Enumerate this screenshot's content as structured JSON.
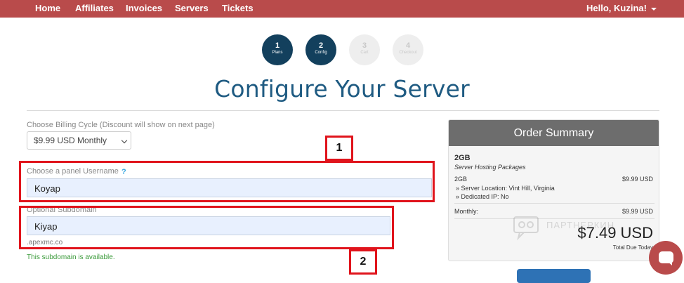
{
  "nav": {
    "links": [
      "Home",
      "Affiliates",
      "Invoices",
      "Servers",
      "Tickets"
    ],
    "user_greeting": "Hello, Kuzina!"
  },
  "steps": [
    {
      "num": "1",
      "label": "Plans",
      "state": "active"
    },
    {
      "num": "2",
      "label": "Config",
      "state": "active"
    },
    {
      "num": "3",
      "label": "Cart",
      "state": "inactive"
    },
    {
      "num": "4",
      "label": "Checkout",
      "state": "inactive"
    }
  ],
  "page_title": "Configure Your Server",
  "form": {
    "billing_label": "Choose Billing Cycle (Discount will show on next page)",
    "billing_value": "$9.99 USD Monthly",
    "username_label": "Choose a panel Username",
    "help_glyph": "?",
    "username_value": "Koyap",
    "subdomain_label": "Optional Subdomain",
    "subdomain_value": "Kiyap",
    "domain_suffix": ".apexmc.co",
    "availability_msg": "This subdomain is available."
  },
  "annotations": [
    "1",
    "2"
  ],
  "order_summary": {
    "title": "Order Summary",
    "product": "2GB",
    "product_group": "Server Hosting Packages",
    "line_name": "2GB",
    "line_price": "$9.99 USD",
    "details": [
      "» Server Location: Vint Hill, Virginia",
      "» Dedicated IP: No"
    ],
    "monthly_label": "Monthly:",
    "monthly_price": "$9.99 USD",
    "total": "$7.49 USD",
    "total_label": "Total Due Today"
  },
  "watermark_text": "ПАРТНЕРКИН",
  "colors": {
    "nav_bg": "#b94b4b",
    "step_active": "#13405d",
    "title": "#1f5b82",
    "annotation": "#e0141c",
    "success": "#3a9a3a",
    "summary_header": "#6d6d6d"
  }
}
